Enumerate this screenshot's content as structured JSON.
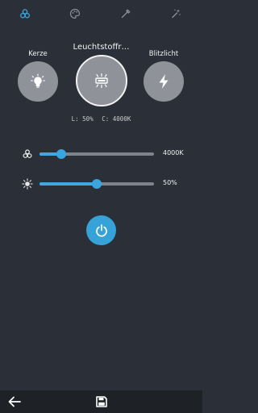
{
  "tabs": [
    {
      "icon": "color-circles-icon",
      "active": true
    },
    {
      "icon": "palette-icon",
      "active": false
    },
    {
      "icon": "pipette-icon",
      "active": false
    },
    {
      "icon": "magic-wand-icon",
      "active": false
    }
  ],
  "modes": {
    "left": {
      "label": "Kerze",
      "icon": "candle-bulb-icon"
    },
    "center": {
      "label": "Leuchtstoffr…",
      "icon": "fluorescent-lamp-icon",
      "selected": true
    },
    "right": {
      "label": "Blitzlicht",
      "icon": "flash-icon"
    }
  },
  "readout": {
    "level": "L: 50%",
    "color_temp": "C: 4000K"
  },
  "sliders": {
    "temperature": {
      "icon": "color-temperature-icon",
      "value_label": "4000K",
      "fraction": 0.19
    },
    "brightness": {
      "icon": "brightness-sun-icon",
      "value_label": "50%",
      "fraction": 0.5
    }
  },
  "power": {
    "icon": "power-icon"
  },
  "bottom": {
    "back_icon": "back-arrow-icon",
    "save_icon": "save-icon"
  },
  "colors": {
    "accent": "#3fa8e0",
    "background": "#2b3038",
    "circle": "#8f9399",
    "bottom_bar": "#1e2227"
  }
}
